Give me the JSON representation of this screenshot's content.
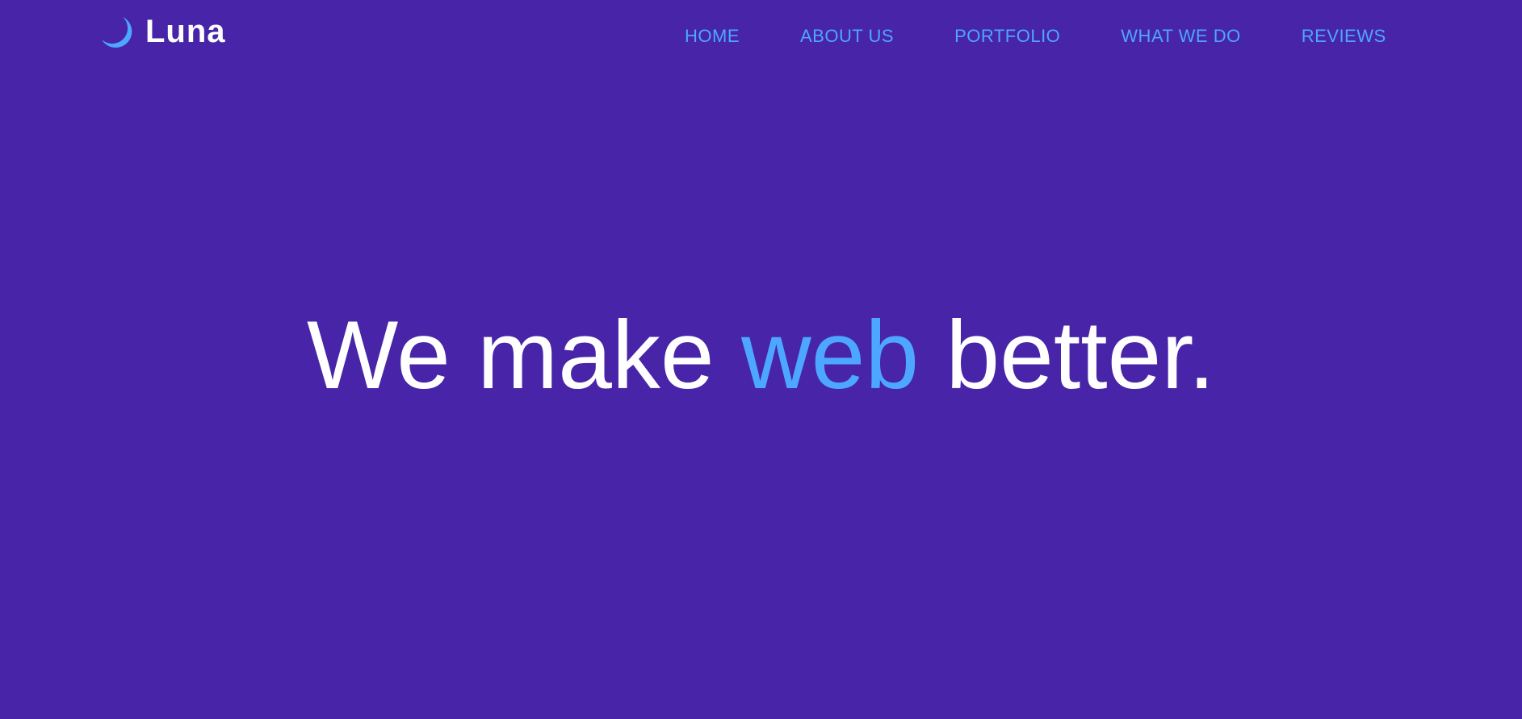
{
  "brand": {
    "name": "Luna",
    "icon": "moon-icon"
  },
  "nav": {
    "items": [
      {
        "label": "HOME"
      },
      {
        "label": "ABOUT US"
      },
      {
        "label": "PORTFOLIO"
      },
      {
        "label": "WHAT WE DO"
      },
      {
        "label": "REVIEWS"
      }
    ]
  },
  "hero": {
    "text_before": "We make",
    "highlight": "web",
    "text_after": "better."
  },
  "colors": {
    "background": "#4824a8",
    "accent": "#4da6ff",
    "text": "#ffffff"
  }
}
